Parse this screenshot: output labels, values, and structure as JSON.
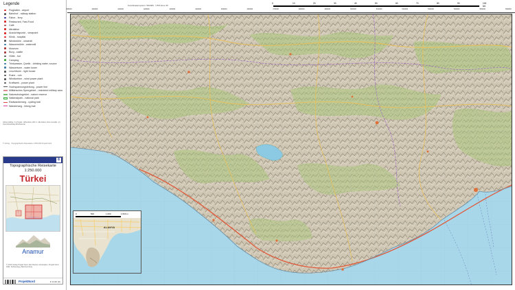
{
  "legend": {
    "title": "Legende",
    "items": [
      {
        "label": "Flughafen - airport",
        "color": "#d22"
      },
      {
        "label": "Bahnhof - railway station",
        "color": "#555"
      },
      {
        "label": "Fähre - ferry",
        "color": "#33a"
      },
      {
        "label": "Restaurant, Fast-Food",
        "color": "#d22"
      },
      {
        "label": "Café",
        "color": "#a55"
      },
      {
        "label": "Attraktion",
        "color": "#d22"
      },
      {
        "label": "Aussichtspunkt - viewpoint",
        "color": "#d22"
      },
      {
        "label": "Klinik - hospital",
        "color": "#d22"
      },
      {
        "label": "Windmühle - windmill",
        "color": "#555"
      },
      {
        "label": "Wassermühle - watermill",
        "color": "#37a"
      },
      {
        "label": "Museum",
        "color": "#a33"
      },
      {
        "label": "Burg - castle",
        "color": "#a33"
      },
      {
        "label": "Hütte - hut",
        "color": "#555"
      },
      {
        "label": "Camping",
        "color": "#3a3"
      },
      {
        "label": "Trinkwasser, Quelle - drinking water, source",
        "color": "#37a"
      },
      {
        "label": "Wasserturm - water tower",
        "color": "#37a"
      },
      {
        "label": "Leuchtturm - light house",
        "color": "#555"
      },
      {
        "label": "Ruine - ruin",
        "color": "#555"
      },
      {
        "label": "Windturbine - wind power plant",
        "color": "#555"
      },
      {
        "label": "Kraftwerk - power plant",
        "color": "#555"
      },
      {
        "label": "Hochspannungsleitung - power line",
        "color": "#555"
      },
      {
        "label": "Militärisches Sperrgebiet - restricted military area",
        "color": "#d88"
      },
      {
        "label": "Naturschutzgebiet - nature reserve",
        "color": "#7b7"
      },
      {
        "label": "Nationalpark - national park",
        "color": "#3a3"
      },
      {
        "label": "Radwanderweg - cycling trail",
        "color": "#d44"
      },
      {
        "label": "Wanderweg - hiking trail",
        "color": "#d4a"
      }
    ],
    "note": "Höhen-Maße, Im Projekt. Höhenlinie 100 m. Alle Daten ohne Gewähr. (c) OpenStreetMap Mitwirkende",
    "credit": "© Verlag · Topographische Reisekarte 1:250.000 Projekt Nord"
  },
  "cover": {
    "number": "8",
    "series": "Topographische Reisekarte",
    "scale": "1:250.000",
    "country": "Türkei",
    "name": "Anamur",
    "imprint": "© 2016 Verlag Projekt Nord. Alle Rechte vorbehalten. Projekt Nord GbR, Schlossweg, Bad Homburg",
    "publisher": "ProjektNord",
    "price": "€ 14,90 (D)"
  },
  "map": {
    "caption": "Koordinatensystem: WGS84 · UTM Zone 36",
    "scale_ticks": [
      "0",
      "10",
      "20",
      "30",
      "40",
      "50",
      "60",
      "70",
      "80",
      "90",
      "100 km"
    ],
    "top_coords": [
      "396000",
      "400000",
      "410000",
      "420000",
      "430000",
      "440000",
      "450000",
      "460000",
      "470000",
      "480000",
      "490000",
      "500000",
      "510000",
      "520000",
      "530000",
      "540000",
      "550000",
      "560000"
    ],
    "inset": {
      "ticks": [
        "0",
        "500",
        "1.000",
        "1.500 m"
      ],
      "city": "ALANYA"
    }
  }
}
